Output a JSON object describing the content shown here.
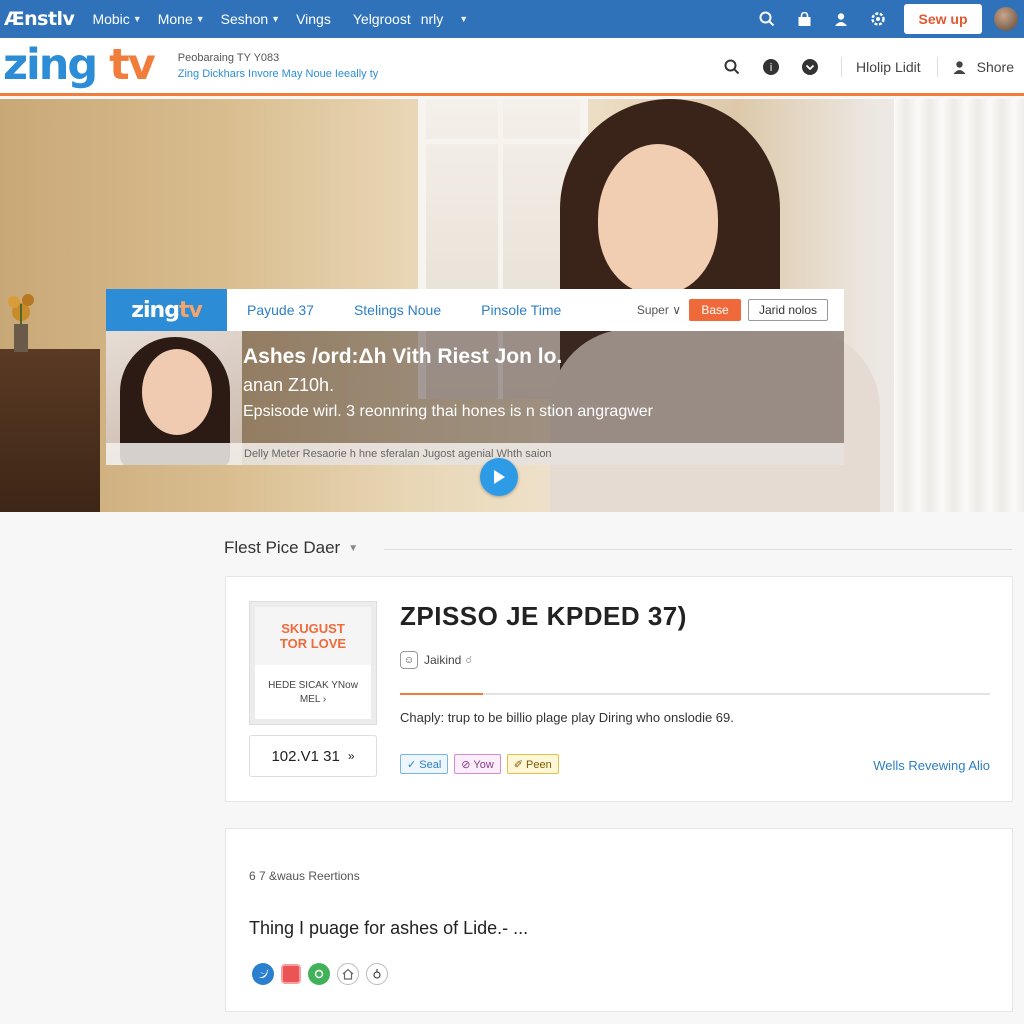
{
  "topnav": {
    "brand": "Ænstlv",
    "items": [
      {
        "label": "Mobic",
        "caret": true
      },
      {
        "label": "Mone",
        "caret": true
      },
      {
        "label": "Seshon",
        "caret": true
      },
      {
        "label": "Vings",
        "caret": false
      },
      {
        "label": "Yelgroost",
        "caret": false
      },
      {
        "label": "nrly",
        "caret": true
      }
    ],
    "icons": [
      "search-icon",
      "bag-icon",
      "user-icon",
      "settings-icon"
    ],
    "signup_label": "Sew up"
  },
  "subheader": {
    "logo_main": "zing",
    "logo_accent": "tv",
    "line1": "Peobaraing TY Y083",
    "line2": "Zing Dickhars Invore May Noue Ieeally ty",
    "icons": [
      "search-icon",
      "info-icon",
      "chevron-down-icon"
    ],
    "help_label": "Hlolip Lidit",
    "share_label": "Shore"
  },
  "player": {
    "logo_main": "zing",
    "logo_accent": "tv",
    "tabs": [
      "Payude  37",
      "Stelings Noue",
      "Pinsole Time"
    ],
    "select_label": "Super",
    "orange_btn": "Base",
    "white_btn": "Jarid nolos",
    "title": "Ashes /ord:Δh Vith Riest Jon lo.",
    "subtitle": "anan Z10h.",
    "description": "Epsisode wirl. 3 reonnring thai hones is n stion angragwer",
    "footer": "Delly Meter Resaorie h hne sferalan Jugost agenial Whth saion"
  },
  "section": {
    "title": "Flest Pice Daer"
  },
  "episode_card": {
    "poster_line1": "SKUGUST",
    "poster_line2": "TOR LOVE",
    "poster_line3": "HEDE SICAK YNow",
    "poster_line4": "MEL ›",
    "episode_box": "102.V1 31",
    "episode_box_arrow": "»",
    "title": "ZPISSO JE KPDED 37)",
    "author": "Jaikind",
    "author_extra": "☌",
    "progress": 0.14,
    "description": "Chaply: trup to be billio plage play Diring who onslodie 69.",
    "tags": [
      "✓ Seal",
      "⊘ Yow",
      "✐ Peen"
    ],
    "link": "Wells Revewing Alio"
  },
  "review_card": {
    "meta": "6 7 &waus Reertions",
    "text": "Thing I puage for ashes of Lide.- ...",
    "social_icons": [
      "twitter-icon",
      "share-square-icon",
      "share-green-icon",
      "home-icon",
      "info-circle-icon"
    ]
  },
  "colors": {
    "nav_blue": "#2f72b9",
    "brand_blue": "#2c8dd6",
    "accent_orange": "#f07d3c"
  }
}
